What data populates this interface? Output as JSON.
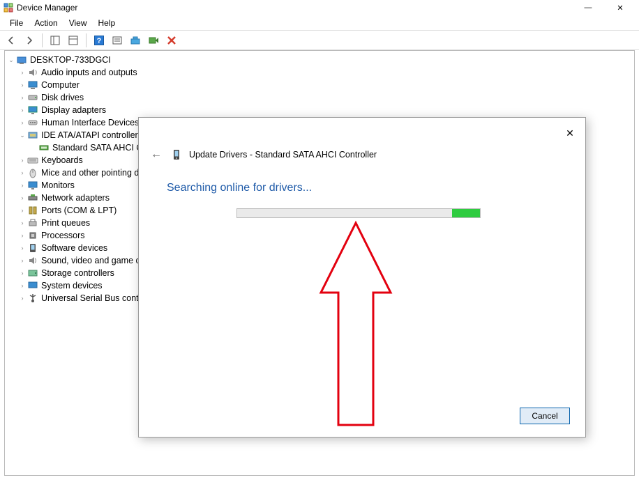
{
  "window": {
    "title": "Device Manager",
    "minimize": "—",
    "close": "✕"
  },
  "menu": {
    "file": "File",
    "action": "Action",
    "view": "View",
    "help": "Help"
  },
  "tree": {
    "root": "DESKTOP-733DGCI",
    "items": [
      {
        "label": "Audio inputs and outputs",
        "icon": "audio"
      },
      {
        "label": "Computer",
        "icon": "computer"
      },
      {
        "label": "Disk drives",
        "icon": "disk"
      },
      {
        "label": "Display adapters",
        "icon": "display"
      },
      {
        "label": "Human Interface Devices",
        "icon": "hid"
      },
      {
        "label": "IDE ATA/ATAPI controllers",
        "icon": "ide",
        "expanded": true,
        "children": [
          {
            "label": "Standard SATA AHCI Controller",
            "icon": "ide-child"
          }
        ]
      },
      {
        "label": "Keyboards",
        "icon": "keyboard"
      },
      {
        "label": "Mice and other pointing devices",
        "icon": "mouse"
      },
      {
        "label": "Monitors",
        "icon": "monitor"
      },
      {
        "label": "Network adapters",
        "icon": "network"
      },
      {
        "label": "Ports (COM & LPT)",
        "icon": "ports"
      },
      {
        "label": "Print queues",
        "icon": "print"
      },
      {
        "label": "Processors",
        "icon": "cpu"
      },
      {
        "label": "Software devices",
        "icon": "software"
      },
      {
        "label": "Sound, video and game controllers",
        "icon": "sound"
      },
      {
        "label": "Storage controllers",
        "icon": "storage"
      },
      {
        "label": "System devices",
        "icon": "system"
      },
      {
        "label": "Universal Serial Bus controllers",
        "icon": "usb"
      }
    ]
  },
  "dialog": {
    "title": "Update Drivers - Standard SATA AHCI Controller",
    "message": "Searching online for drivers...",
    "cancel": "Cancel"
  }
}
